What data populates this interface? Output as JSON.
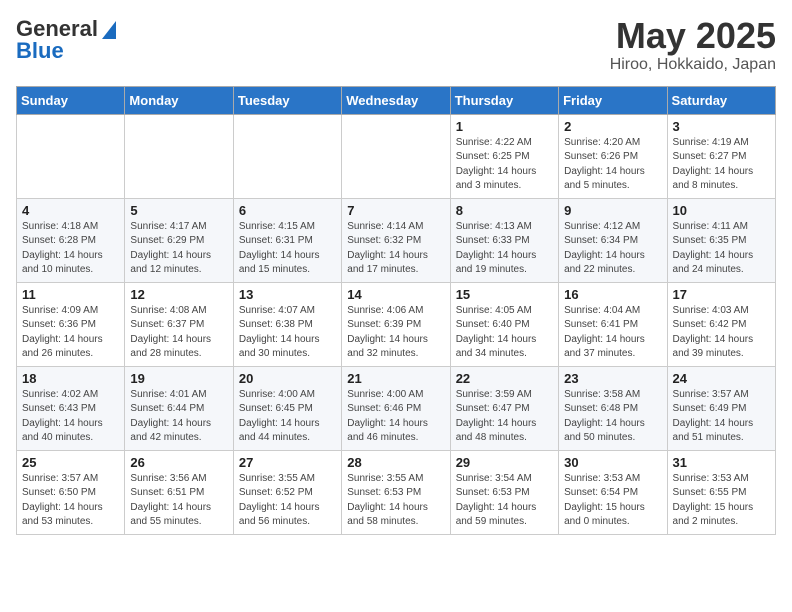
{
  "header": {
    "logo_general": "General",
    "logo_blue": "Blue",
    "month": "May 2025",
    "location": "Hiroo, Hokkaido, Japan"
  },
  "weekdays": [
    "Sunday",
    "Monday",
    "Tuesday",
    "Wednesday",
    "Thursday",
    "Friday",
    "Saturday"
  ],
  "weeks": [
    [
      {
        "day": "",
        "info": ""
      },
      {
        "day": "",
        "info": ""
      },
      {
        "day": "",
        "info": ""
      },
      {
        "day": "",
        "info": ""
      },
      {
        "day": "1",
        "info": "Sunrise: 4:22 AM\nSunset: 6:25 PM\nDaylight: 14 hours\nand 3 minutes."
      },
      {
        "day": "2",
        "info": "Sunrise: 4:20 AM\nSunset: 6:26 PM\nDaylight: 14 hours\nand 5 minutes."
      },
      {
        "day": "3",
        "info": "Sunrise: 4:19 AM\nSunset: 6:27 PM\nDaylight: 14 hours\nand 8 minutes."
      }
    ],
    [
      {
        "day": "4",
        "info": "Sunrise: 4:18 AM\nSunset: 6:28 PM\nDaylight: 14 hours\nand 10 minutes."
      },
      {
        "day": "5",
        "info": "Sunrise: 4:17 AM\nSunset: 6:29 PM\nDaylight: 14 hours\nand 12 minutes."
      },
      {
        "day": "6",
        "info": "Sunrise: 4:15 AM\nSunset: 6:31 PM\nDaylight: 14 hours\nand 15 minutes."
      },
      {
        "day": "7",
        "info": "Sunrise: 4:14 AM\nSunset: 6:32 PM\nDaylight: 14 hours\nand 17 minutes."
      },
      {
        "day": "8",
        "info": "Sunrise: 4:13 AM\nSunset: 6:33 PM\nDaylight: 14 hours\nand 19 minutes."
      },
      {
        "day": "9",
        "info": "Sunrise: 4:12 AM\nSunset: 6:34 PM\nDaylight: 14 hours\nand 22 minutes."
      },
      {
        "day": "10",
        "info": "Sunrise: 4:11 AM\nSunset: 6:35 PM\nDaylight: 14 hours\nand 24 minutes."
      }
    ],
    [
      {
        "day": "11",
        "info": "Sunrise: 4:09 AM\nSunset: 6:36 PM\nDaylight: 14 hours\nand 26 minutes."
      },
      {
        "day": "12",
        "info": "Sunrise: 4:08 AM\nSunset: 6:37 PM\nDaylight: 14 hours\nand 28 minutes."
      },
      {
        "day": "13",
        "info": "Sunrise: 4:07 AM\nSunset: 6:38 PM\nDaylight: 14 hours\nand 30 minutes."
      },
      {
        "day": "14",
        "info": "Sunrise: 4:06 AM\nSunset: 6:39 PM\nDaylight: 14 hours\nand 32 minutes."
      },
      {
        "day": "15",
        "info": "Sunrise: 4:05 AM\nSunset: 6:40 PM\nDaylight: 14 hours\nand 34 minutes."
      },
      {
        "day": "16",
        "info": "Sunrise: 4:04 AM\nSunset: 6:41 PM\nDaylight: 14 hours\nand 37 minutes."
      },
      {
        "day": "17",
        "info": "Sunrise: 4:03 AM\nSunset: 6:42 PM\nDaylight: 14 hours\nand 39 minutes."
      }
    ],
    [
      {
        "day": "18",
        "info": "Sunrise: 4:02 AM\nSunset: 6:43 PM\nDaylight: 14 hours\nand 40 minutes."
      },
      {
        "day": "19",
        "info": "Sunrise: 4:01 AM\nSunset: 6:44 PM\nDaylight: 14 hours\nand 42 minutes."
      },
      {
        "day": "20",
        "info": "Sunrise: 4:00 AM\nSunset: 6:45 PM\nDaylight: 14 hours\nand 44 minutes."
      },
      {
        "day": "21",
        "info": "Sunrise: 4:00 AM\nSunset: 6:46 PM\nDaylight: 14 hours\nand 46 minutes."
      },
      {
        "day": "22",
        "info": "Sunrise: 3:59 AM\nSunset: 6:47 PM\nDaylight: 14 hours\nand 48 minutes."
      },
      {
        "day": "23",
        "info": "Sunrise: 3:58 AM\nSunset: 6:48 PM\nDaylight: 14 hours\nand 50 minutes."
      },
      {
        "day": "24",
        "info": "Sunrise: 3:57 AM\nSunset: 6:49 PM\nDaylight: 14 hours\nand 51 minutes."
      }
    ],
    [
      {
        "day": "25",
        "info": "Sunrise: 3:57 AM\nSunset: 6:50 PM\nDaylight: 14 hours\nand 53 minutes."
      },
      {
        "day": "26",
        "info": "Sunrise: 3:56 AM\nSunset: 6:51 PM\nDaylight: 14 hours\nand 55 minutes."
      },
      {
        "day": "27",
        "info": "Sunrise: 3:55 AM\nSunset: 6:52 PM\nDaylight: 14 hours\nand 56 minutes."
      },
      {
        "day": "28",
        "info": "Sunrise: 3:55 AM\nSunset: 6:53 PM\nDaylight: 14 hours\nand 58 minutes."
      },
      {
        "day": "29",
        "info": "Sunrise: 3:54 AM\nSunset: 6:53 PM\nDaylight: 14 hours\nand 59 minutes."
      },
      {
        "day": "30",
        "info": "Sunrise: 3:53 AM\nSunset: 6:54 PM\nDaylight: 15 hours\nand 0 minutes."
      },
      {
        "day": "31",
        "info": "Sunrise: 3:53 AM\nSunset: 6:55 PM\nDaylight: 15 hours\nand 2 minutes."
      }
    ]
  ]
}
